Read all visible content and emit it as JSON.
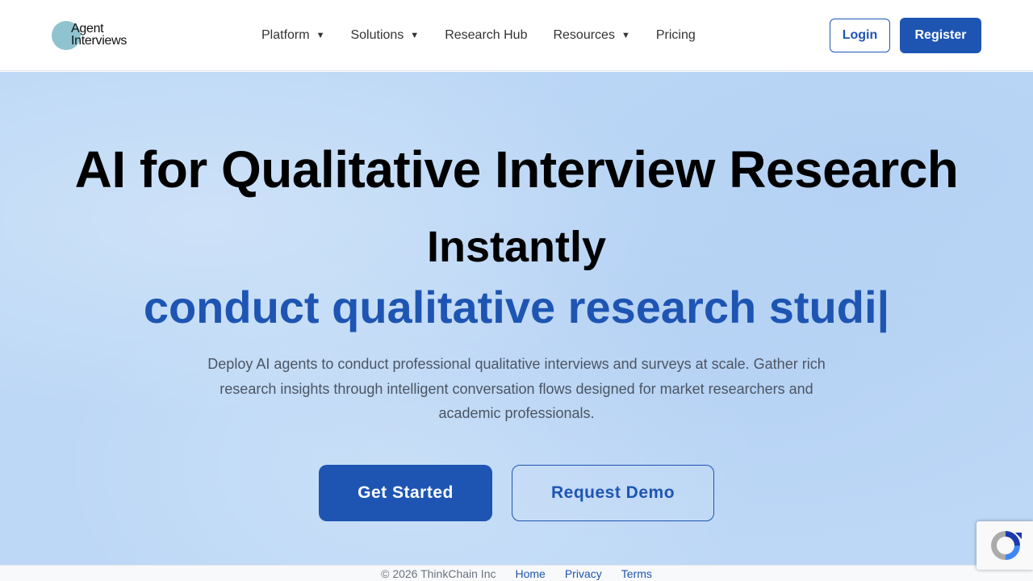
{
  "header": {
    "logo": {
      "line1": "Agent",
      "line2": "Interviews"
    },
    "nav": [
      {
        "label": "Platform",
        "has_dropdown": true
      },
      {
        "label": "Solutions",
        "has_dropdown": true
      },
      {
        "label": "Research Hub",
        "has_dropdown": false
      },
      {
        "label": "Resources",
        "has_dropdown": true
      },
      {
        "label": "Pricing",
        "has_dropdown": false
      }
    ],
    "dropdown_glyph": "▼",
    "login_label": "Login",
    "register_label": "Register"
  },
  "hero": {
    "title": "AI for Qualitative Interview Research",
    "subtitle": "Instantly",
    "typed_text": "conduct qualitative research studi|",
    "description": "Deploy AI agents to conduct professional qualitative interviews and surveys at scale. Gather rich research insights through intelligent conversation flows designed for market researchers and academic professionals.",
    "primary_cta": "Get Started",
    "secondary_cta": "Request Demo"
  },
  "footer": {
    "copyright": "© 2026 ThinkChain Inc",
    "links": [
      "Home",
      "Privacy",
      "Terms"
    ]
  },
  "colors": {
    "brand_blue": "#1e55b3",
    "hero_background": "#bdd8f6",
    "logo_circle": "#8fc3cf"
  },
  "icons": {
    "recaptcha": "recaptcha-icon"
  }
}
